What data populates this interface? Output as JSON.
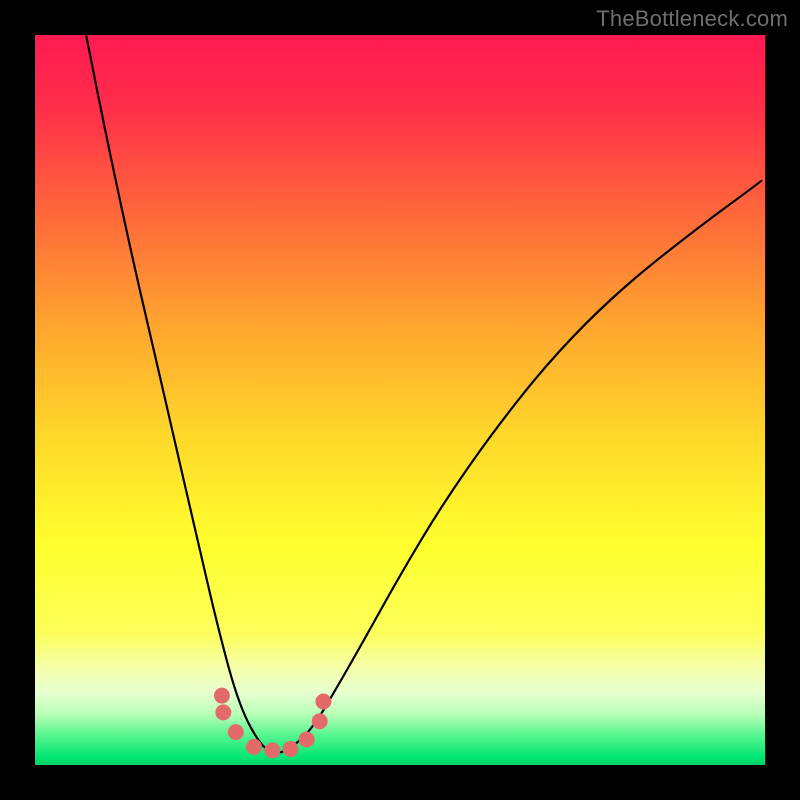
{
  "watermark": "TheBottleneck.com",
  "gradient_stops": [
    {
      "offset": 0.0,
      "color": "#ff1a52"
    },
    {
      "offset": 0.1,
      "color": "#ff2e4a"
    },
    {
      "offset": 0.25,
      "color": "#ff6a3a"
    },
    {
      "offset": 0.4,
      "color": "#ffa62f"
    },
    {
      "offset": 0.55,
      "color": "#ffd82a"
    },
    {
      "offset": 0.7,
      "color": "#ffff2e"
    },
    {
      "offset": 0.82,
      "color": "#fcff5a"
    },
    {
      "offset": 0.86,
      "color": "#f6ffa0"
    },
    {
      "offset": 0.9,
      "color": "#e8ffd0"
    },
    {
      "offset": 0.93,
      "color": "#b8ffb8"
    },
    {
      "offset": 0.96,
      "color": "#55f58e"
    },
    {
      "offset": 0.99,
      "color": "#00e673"
    },
    {
      "offset": 1.0,
      "color": "#00d267"
    }
  ],
  "curve": {
    "stroke": "#000000",
    "stroke_width": 2.2
  },
  "markers": {
    "fill": "#e46a6a",
    "radius": 8,
    "points_xy_norm": [
      [
        0.256,
        0.905
      ],
      [
        0.258,
        0.928
      ],
      [
        0.275,
        0.955
      ],
      [
        0.3,
        0.975
      ],
      [
        0.325,
        0.98
      ],
      [
        0.35,
        0.978
      ],
      [
        0.372,
        0.965
      ],
      [
        0.39,
        0.94
      ],
      [
        0.395,
        0.913
      ]
    ]
  },
  "chart_data": {
    "type": "line",
    "title": "",
    "xlabel": "",
    "ylabel": "",
    "xlim": [
      0,
      1
    ],
    "ylim": [
      0,
      1
    ],
    "series": [
      {
        "name": "curve",
        "x": [
          0.07,
          0.1,
          0.13,
          0.16,
          0.19,
          0.22,
          0.25,
          0.28,
          0.31,
          0.33,
          0.35,
          0.38,
          0.41,
          0.45,
          0.5,
          0.56,
          0.63,
          0.71,
          0.8,
          0.9,
          0.995
        ],
        "y": [
          0.0,
          0.15,
          0.29,
          0.42,
          0.55,
          0.68,
          0.81,
          0.92,
          0.975,
          0.985,
          0.978,
          0.95,
          0.9,
          0.83,
          0.74,
          0.64,
          0.54,
          0.44,
          0.35,
          0.27,
          0.2
        ]
      }
    ],
    "markers": [
      {
        "x": 0.256,
        "y": 0.905
      },
      {
        "x": 0.258,
        "y": 0.928
      },
      {
        "x": 0.275,
        "y": 0.955
      },
      {
        "x": 0.3,
        "y": 0.975
      },
      {
        "x": 0.325,
        "y": 0.98
      },
      {
        "x": 0.35,
        "y": 0.978
      },
      {
        "x": 0.372,
        "y": 0.965
      },
      {
        "x": 0.39,
        "y": 0.94
      },
      {
        "x": 0.395,
        "y": 0.913
      }
    ]
  }
}
